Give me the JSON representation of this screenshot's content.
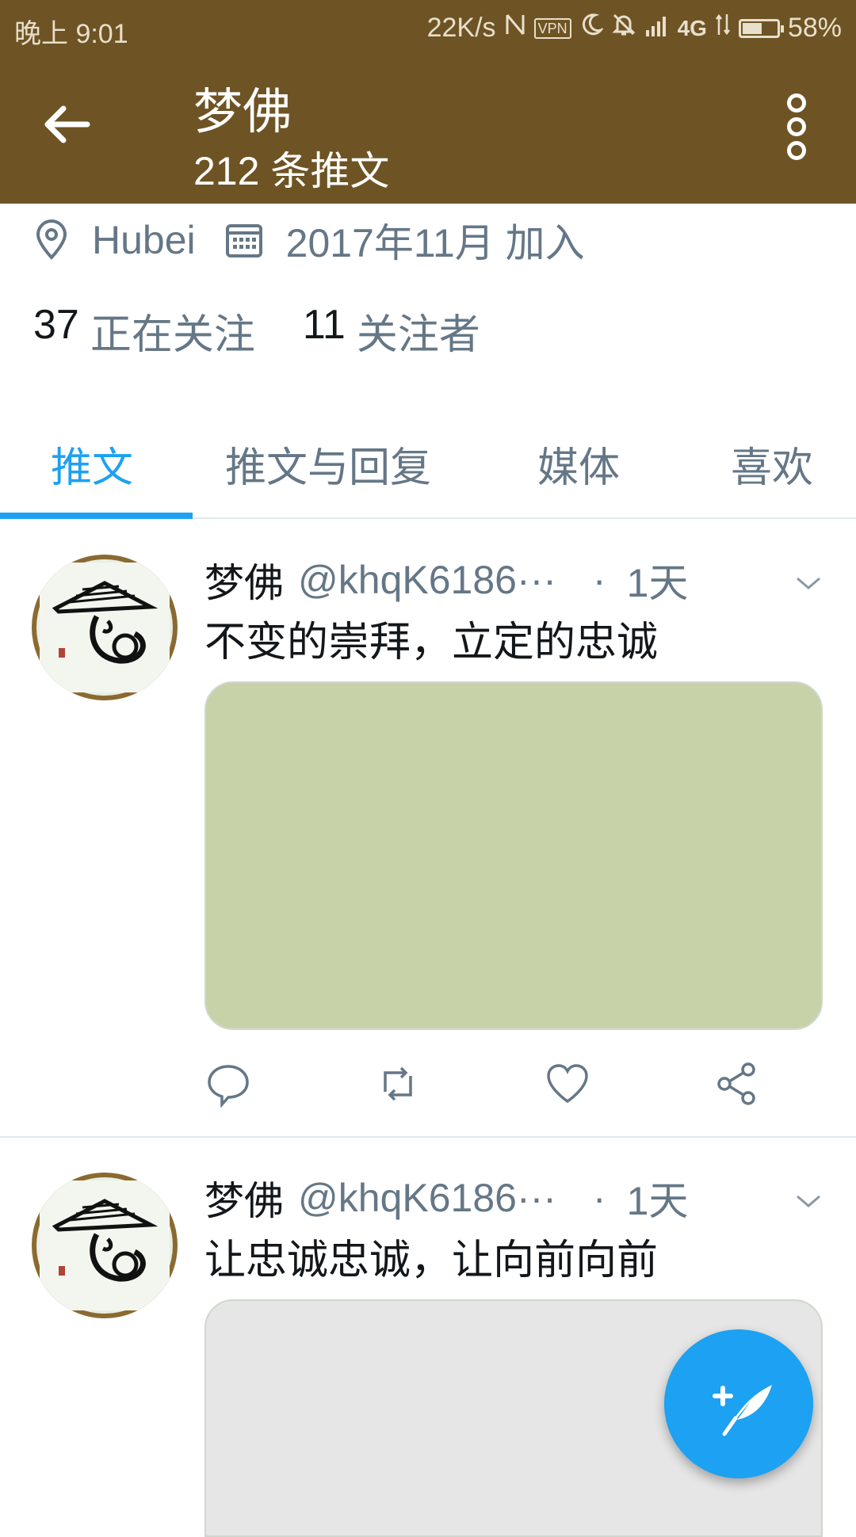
{
  "status_bar": {
    "time": "晚上 9:01",
    "net_speed": "22K/s",
    "vpn_label": "VPN",
    "network": "4G",
    "battery_percent": "58%",
    "battery_level": 0.58
  },
  "header": {
    "title": "梦佛",
    "tweet_count": "212 条推文",
    "background_color": "#6e5424"
  },
  "profile": {
    "location": "Hubei",
    "joined": "2017年11月 加入",
    "following_count": "37",
    "following_label": "正在关注",
    "followers_count": "11",
    "followers_label": "关注者"
  },
  "tabs": [
    {
      "label": "推文",
      "active": true
    },
    {
      "label": "推文与回复",
      "active": false
    },
    {
      "label": "媒体",
      "active": false
    },
    {
      "label": "喜欢",
      "active": false
    }
  ],
  "tweets": [
    {
      "name": "梦佛",
      "handle": "@khqK6186···",
      "separator": "·",
      "time": "1天",
      "text": "不变的崇拜，立定的忠诚",
      "media_color": "#c8d2a8"
    },
    {
      "name": "梦佛",
      "handle": "@khqK6186···",
      "separator": "·",
      "time": "1天",
      "text": "让忠诚忠诚，让向前向前",
      "media_color": "#e6e6e6"
    }
  ],
  "colors": {
    "accent": "#1da1f2",
    "secondary_text": "#657786",
    "primary_text": "#14171a"
  }
}
